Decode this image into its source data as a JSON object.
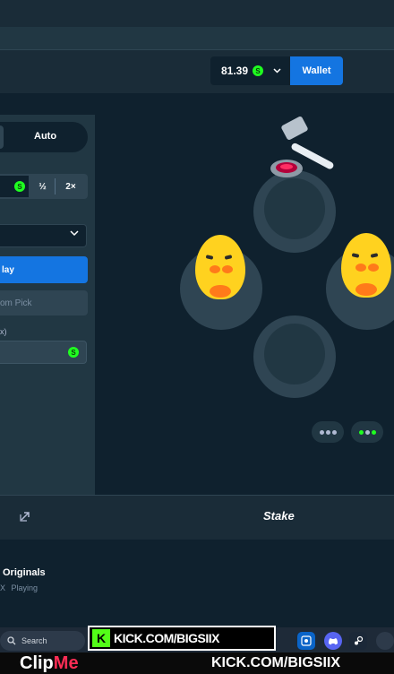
{
  "header": {
    "balance": "81.39",
    "currency_symbol": "S",
    "wallet_label": "Wallet"
  },
  "sidebar": {
    "auto_tab": "Auto",
    "bet_currency_symbol": "S",
    "half_label": "½",
    "double_label": "2×",
    "play_label": "lay",
    "random_pick_label": "om Pick",
    "profit_label": "x)",
    "profit_currency_symbol": "S"
  },
  "footer": {
    "stake_logo": "Stake",
    "originals_title": "Originals",
    "playing_label": "Playing",
    "playing_prefix": "X"
  },
  "taskbar": {
    "search_label": "Search"
  },
  "overlay": {
    "kick_banner": "KICK.COM/BIGSIIX",
    "clip_logo_a": "Clip",
    "clip_logo_b": "Me",
    "caption_url": "KICK.COM/BIGSIIX"
  },
  "colors": {
    "background": "#0f212e",
    "panel": "#213743",
    "accent_blue": "#1475e1",
    "coin_green": "#1fff20",
    "mole_yellow": "#ffd21f"
  }
}
